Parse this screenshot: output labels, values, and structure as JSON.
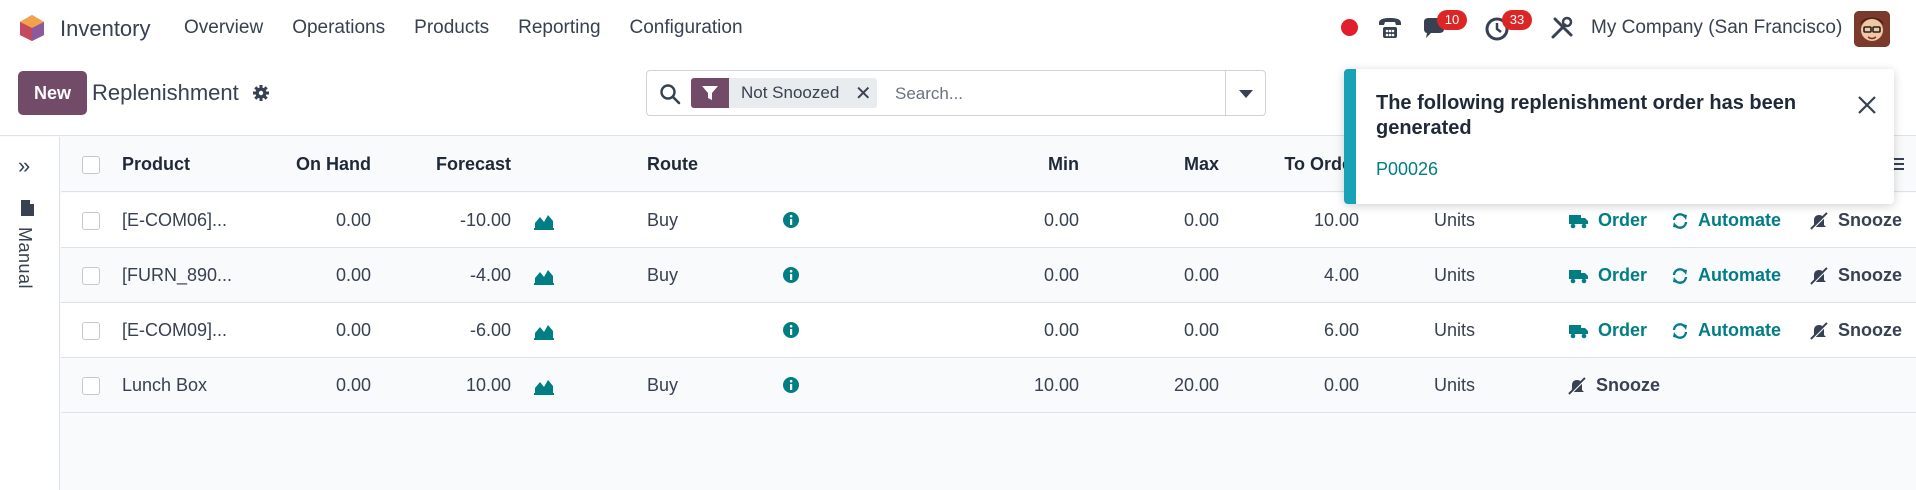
{
  "navbar": {
    "app_name": "Inventory",
    "menu": [
      "Overview",
      "Operations",
      "Products",
      "Reporting",
      "Configuration"
    ],
    "chat_badge": "10",
    "activity_badge": "33",
    "company": "My Company (San Francisco)"
  },
  "control": {
    "new_label": "New",
    "breadcrumb": "Replenishment",
    "facet": "Not Snoozed",
    "search_placeholder": "Search..."
  },
  "sidepanel": {
    "label": "Manual"
  },
  "list": {
    "columns": {
      "product": "Product",
      "on_hand": "On Hand",
      "forecast": "Forecast",
      "route": "Route",
      "min": "Min",
      "max": "Max",
      "to_order": "To Order"
    },
    "rows": [
      {
        "product": "[E-COM06]...",
        "on_hand": "0.00",
        "forecast": "-10.00",
        "route": "Buy",
        "min": "0.00",
        "max": "0.00",
        "to_order": "10.00",
        "uom": "Units"
      },
      {
        "product": "[FURN_890...",
        "on_hand": "0.00",
        "forecast": "-4.00",
        "route": "Buy",
        "min": "0.00",
        "max": "0.00",
        "to_order": "4.00",
        "uom": "Units"
      },
      {
        "product": "[E-COM09]...",
        "on_hand": "0.00",
        "forecast": "-6.00",
        "route": "",
        "min": "0.00",
        "max": "0.00",
        "to_order": "6.00",
        "uom": "Units"
      },
      {
        "product": "Lunch Box",
        "on_hand": "0.00",
        "forecast": "10.00",
        "route": "Buy",
        "min": "10.00",
        "max": "20.00",
        "to_order": "0.00",
        "uom": "Units"
      }
    ],
    "actions": {
      "order": "Order",
      "automate": "Automate",
      "snooze": "Snooze"
    }
  },
  "toast": {
    "title": "The following replenishment order has been generated",
    "link": "P00026"
  },
  "colors": {
    "brand": "#714b67",
    "accent": "#017e84",
    "toast_bar": "#17a2b8",
    "badge": "#dc2626"
  }
}
